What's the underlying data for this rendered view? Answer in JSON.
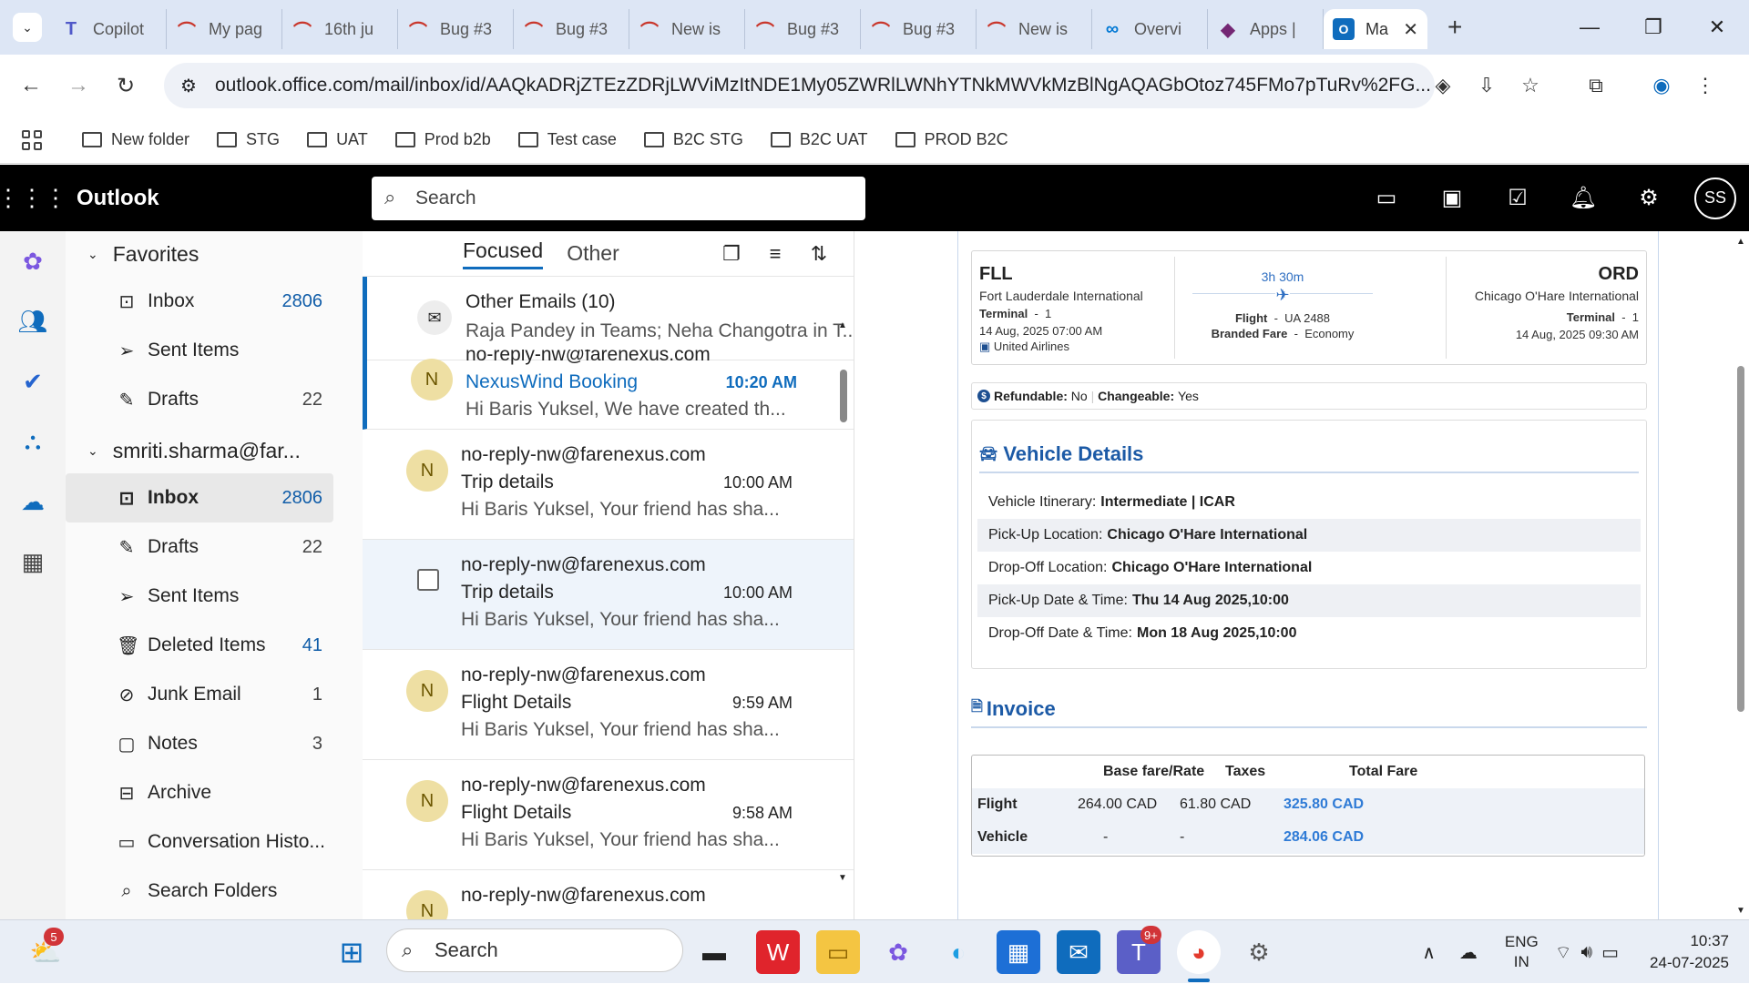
{
  "browser": {
    "tabs": [
      {
        "label": "Copilot",
        "icon": "teams-icon"
      },
      {
        "label": "My pag",
        "icon": "jira-icon"
      },
      {
        "label": "16th ju",
        "icon": "jira-icon"
      },
      {
        "label": "Bug #3",
        "icon": "jira-icon"
      },
      {
        "label": "Bug #3",
        "icon": "jira-icon"
      },
      {
        "label": "New is",
        "icon": "jira-icon"
      },
      {
        "label": "Bug #3",
        "icon": "jira-icon"
      },
      {
        "label": "Bug #3",
        "icon": "jira-icon"
      },
      {
        "label": "New is",
        "icon": "jira-icon"
      },
      {
        "label": "Overvi",
        "icon": "azure-devops-icon"
      },
      {
        "label": "Apps |",
        "icon": "power-apps-icon"
      }
    ],
    "active_tab": {
      "label": "Ma",
      "icon": "outlook-icon"
    },
    "url": "outlook.office.com/mail/inbox/id/AAQkADRjZTEzZDRjLWViMzItNDE1My05ZWRlLWNhYTNkMWVkMzBlNgAQAGbOtoz745FMo7pTuRv%2FG...",
    "bookmarks": [
      "New folder",
      "STG",
      "UAT",
      "Prod b2b",
      "Test case",
      "B2C STG",
      "B2C UAT",
      "PROD B2C"
    ]
  },
  "outlook": {
    "app_name": "Outlook",
    "search_placeholder": "Search",
    "avatar_initials": "SS"
  },
  "folders": {
    "favorites_label": "Favorites",
    "favorites": [
      {
        "label": "Inbox",
        "count": "2806",
        "icon": "inbox-icon",
        "blue": true
      },
      {
        "label": "Sent Items",
        "count": "",
        "icon": "send-icon",
        "blue": false
      },
      {
        "label": "Drafts",
        "count": "22",
        "icon": "pencil-icon",
        "blue": false
      }
    ],
    "account_label": "smriti.sharma@far...",
    "account_items": [
      {
        "label": "Inbox",
        "count": "2806",
        "icon": "inbox-icon",
        "blue": true,
        "selected": true
      },
      {
        "label": "Drafts",
        "count": "22",
        "icon": "pencil-icon",
        "blue": false
      },
      {
        "label": "Sent Items",
        "count": "",
        "icon": "send-icon",
        "blue": false
      },
      {
        "label": "Deleted Items",
        "count": "41",
        "icon": "trash-icon",
        "blue": true
      },
      {
        "label": "Junk Email",
        "count": "1",
        "icon": "junk-icon",
        "blue": false
      },
      {
        "label": "Notes",
        "count": "3",
        "icon": "note-icon",
        "blue": false
      },
      {
        "label": "Archive",
        "count": "",
        "icon": "archive-icon",
        "blue": false
      },
      {
        "label": "Conversation Histo...",
        "count": "",
        "icon": "folder-icon",
        "blue": false
      },
      {
        "label": "Search Folders",
        "count": "",
        "icon": "search-folder-icon",
        "blue": false
      }
    ]
  },
  "message_list": {
    "tabs": [
      "Focused",
      "Other"
    ],
    "other_group": {
      "title": "Other Emails (10)",
      "preview": "Raja Pandey in Teams; Neha Changotra in T..."
    },
    "messages": [
      {
        "from": "no-reply-nw@farenexus.com",
        "subject": "NexusWind Booking",
        "time": "10:20 AM",
        "preview": "Hi Baris Yuksel, We have created th...",
        "initial": "N",
        "unread": true
      },
      {
        "from": "no-reply-nw@farenexus.com",
        "subject": "Trip details",
        "time": "10:00 AM",
        "preview": "Hi Baris Yuksel, Your friend has sha...",
        "initial": "N"
      },
      {
        "from": "no-reply-nw@farenexus.com",
        "subject": "Trip details",
        "time": "10:00 AM",
        "preview": "Hi Baris Yuksel, Your friend has sha...",
        "initial": "",
        "selected": true
      },
      {
        "from": "no-reply-nw@farenexus.com",
        "subject": "Flight Details",
        "time": "9:59 AM",
        "preview": "Hi Baris Yuksel, Your friend has sha...",
        "initial": "N"
      },
      {
        "from": "no-reply-nw@farenexus.com",
        "subject": "Flight Details",
        "time": "9:58 AM",
        "preview": "Hi Baris Yuksel, Your friend has sha...",
        "initial": "N"
      },
      {
        "from": "no-reply-nw@farenexus.com",
        "subject": "",
        "time": "",
        "preview": "",
        "initial": "N"
      }
    ]
  },
  "reader": {
    "flight": {
      "from_code": "FLL",
      "from_name": "Fort Lauderdale International",
      "from_terminal_label": "Terminal",
      "from_terminal": "1",
      "depart": "14 Aug, 2025 07:00 AM",
      "airline": "United Airlines",
      "duration": "3h 30m",
      "flight_label": "Flight",
      "flight_no": "UA 2488",
      "fare_label": "Branded Fare",
      "fare": "Economy",
      "to_code": "ORD",
      "to_name": "Chicago O'Hare International",
      "to_terminal_label": "Terminal",
      "to_terminal": "1",
      "arrive": "14 Aug, 2025 09:30 AM"
    },
    "refund": {
      "refundable_label": "Refundable:",
      "refundable": "No",
      "changeable_label": "Changeable:",
      "changeable": "Yes"
    },
    "vehicle": {
      "title": "Vehicle Details",
      "rows": [
        {
          "label": "Vehicle Itinerary:",
          "value": "Intermediate | ICAR"
        },
        {
          "label": "Pick-Up Location:",
          "value": "Chicago O'Hare International"
        },
        {
          "label": "Drop-Off Location:",
          "value": "Chicago O'Hare International"
        },
        {
          "label": "Pick-Up Date & Time:",
          "value": "Thu 14 Aug 2025,10:00"
        },
        {
          "label": "Drop-Off Date & Time:",
          "value": "Mon 18 Aug 2025,10:00"
        }
      ]
    },
    "invoice": {
      "title": "Invoice",
      "headers": [
        "Base fare/Rate",
        "Taxes",
        "Total Fare"
      ],
      "rows": [
        {
          "label": "Flight",
          "base": "264.00 CAD",
          "taxes": "61.80 CAD",
          "total": "325.80 CAD"
        },
        {
          "label": "Vehicle",
          "base": "-",
          "taxes": "-",
          "total": "284.06 CAD"
        }
      ]
    }
  },
  "taskbar": {
    "search_placeholder": "Search",
    "weather_badge": "5",
    "teams_badge": "9+",
    "lang_line1": "ENG",
    "lang_line2": "IN",
    "time": "10:37",
    "date": "24-07-2025"
  },
  "colors": {
    "accent": "#0f6cbd",
    "link_blue": "#1c5aa6",
    "total_blue": "#2f7bd6"
  }
}
